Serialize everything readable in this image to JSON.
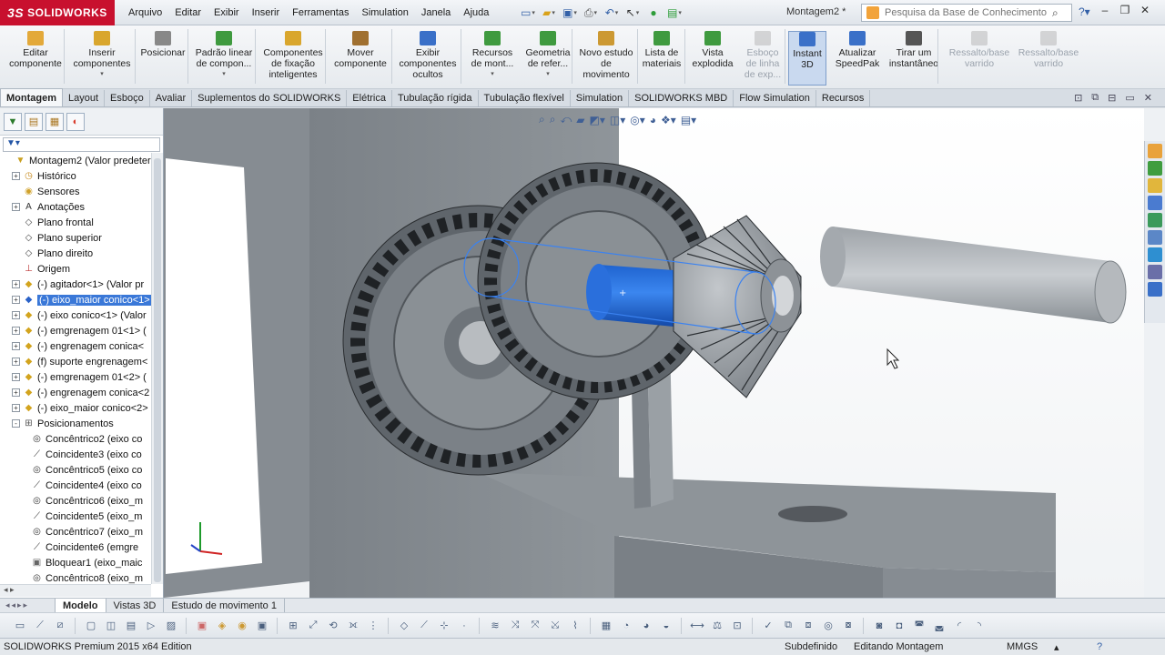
{
  "app": {
    "brand": "SOLIDWORKS",
    "doc_title": "Montagem2 *"
  },
  "menu": [
    "Arquivo",
    "Editar",
    "Exibir",
    "Inserir",
    "Ferramentas",
    "Simulation",
    "Janela",
    "Ajuda"
  ],
  "quick_access_icons": [
    "new-icon",
    "open-icon",
    "save-icon",
    "print-icon",
    "undo-icon",
    "select-icon",
    "rebuild-icon",
    "options-icon"
  ],
  "search": {
    "placeholder": "Pesquisa da Base de Conhecimento"
  },
  "commands": [
    {
      "label": "Editar componente",
      "icon": "edit-component-icon",
      "enabled": true
    },
    {
      "label": "Inserir componentes",
      "icon": "insert-components-icon",
      "enabled": true
    },
    {
      "label": "Posicionar",
      "icon": "mate-icon",
      "enabled": true
    },
    {
      "label": "Padrão linear de compon...",
      "icon": "linear-pattern-icon",
      "enabled": true
    },
    {
      "label": "Componentes de fixação inteligentes",
      "icon": "smart-fasteners-icon",
      "enabled": true
    },
    {
      "label": "Mover componente",
      "icon": "move-component-icon",
      "enabled": true
    },
    {
      "label": "Exibir componentes ocultos",
      "icon": "show-hidden-icon",
      "enabled": true
    },
    {
      "label": "Recursos de mont...",
      "icon": "assembly-features-icon",
      "enabled": true
    },
    {
      "label": "Geometria de refer...",
      "icon": "reference-geometry-icon",
      "enabled": true
    },
    {
      "label": "Novo estudo de movimento",
      "icon": "motion-study-icon",
      "enabled": true
    },
    {
      "label": "Lista de materiais",
      "icon": "bom-icon",
      "enabled": true
    },
    {
      "label": "Vista explodida",
      "icon": "exploded-view-icon",
      "enabled": true
    },
    {
      "label": "Esboço de linha de exp...",
      "icon": "explode-line-icon",
      "enabled": false
    },
    {
      "label": "Instant 3D",
      "icon": "instant3d-icon",
      "enabled": true,
      "active": true
    },
    {
      "label": "Atualizar SpeedPak",
      "icon": "speedpak-icon",
      "enabled": true
    },
    {
      "label": "Tirar um instantâneo",
      "icon": "snapshot-icon",
      "enabled": true
    },
    {
      "label": "Ressalto/base varrido",
      "icon": "sweep-boss-icon",
      "enabled": false
    },
    {
      "label": "Ressalto/base varrido",
      "icon": "sweep-boss-icon",
      "enabled": false
    }
  ],
  "tabs": [
    "Montagem",
    "Layout",
    "Esboço",
    "Avaliar",
    "Suplementos do SOLIDWORKS",
    "Elétrica",
    "Tubulação rígida",
    "Tubulação flexível",
    "Simulation",
    "SOLIDWORKS MBD",
    "Flow Simulation",
    "Recursos"
  ],
  "active_tab": "Montagem",
  "tree": [
    {
      "label": "Montagem2  (Valor predeter",
      "icon": "assembly-icon",
      "expander": "none",
      "indent": 0
    },
    {
      "label": "Histórico",
      "icon": "history-icon",
      "expander": "+",
      "indent": 1
    },
    {
      "label": "Sensores",
      "icon": "sensor-icon",
      "expander": "none",
      "indent": 1
    },
    {
      "label": "Anotações",
      "icon": "annotation-icon",
      "expander": "+",
      "indent": 1
    },
    {
      "label": "Plano frontal",
      "icon": "plane-icon",
      "expander": "none",
      "indent": 1
    },
    {
      "label": "Plano superior",
      "icon": "plane-icon",
      "expander": "none",
      "indent": 1
    },
    {
      "label": "Plano direito",
      "icon": "plane-icon",
      "expander": "none",
      "indent": 1
    },
    {
      "label": "Origem",
      "icon": "origin-icon",
      "expander": "none",
      "indent": 1
    },
    {
      "label": "(-) agitador<1> (Valor pr",
      "icon": "part-icon",
      "expander": "+",
      "indent": 1
    },
    {
      "label": "(-) eixo_maior conico<1>",
      "icon": "part-icon",
      "expander": "+",
      "indent": 1,
      "selected": true
    },
    {
      "label": "(-) eixo conico<1> (Valor",
      "icon": "part-icon",
      "expander": "+",
      "indent": 1
    },
    {
      "label": "(-) emgrenagem 01<1> (",
      "icon": "part-icon",
      "expander": "+",
      "indent": 1
    },
    {
      "label": "(-) engrenagem conica<",
      "icon": "part-icon",
      "expander": "+",
      "indent": 1
    },
    {
      "label": "(f) suporte engrenagem<",
      "icon": "part-icon",
      "expander": "+",
      "indent": 1
    },
    {
      "label": "(-) emgrenagem 01<2> (",
      "icon": "part-icon",
      "expander": "+",
      "indent": 1
    },
    {
      "label": "(-) engrenagem conica<2",
      "icon": "part-icon",
      "expander": "+",
      "indent": 1
    },
    {
      "label": "(-) eixo_maior conico<2>",
      "icon": "part-icon",
      "expander": "+",
      "indent": 1
    },
    {
      "label": "Posicionamentos",
      "icon": "mates-folder-icon",
      "expander": "-",
      "indent": 1
    },
    {
      "label": "Concêntrico2 (eixo co",
      "icon": "concentric-icon",
      "expander": "none",
      "indent": 2
    },
    {
      "label": "Coincidente3 (eixo co",
      "icon": "coincident-icon",
      "expander": "none",
      "indent": 2
    },
    {
      "label": "Concêntrico5 (eixo co",
      "icon": "concentric-icon",
      "expander": "none",
      "indent": 2
    },
    {
      "label": "Coincidente4 (eixo co",
      "icon": "coincident-icon",
      "expander": "none",
      "indent": 2
    },
    {
      "label": "Concêntrico6 (eixo_m",
      "icon": "concentric-icon",
      "expander": "none",
      "indent": 2
    },
    {
      "label": "Coincidente5 (eixo_m",
      "icon": "coincident-icon",
      "expander": "none",
      "indent": 2
    },
    {
      "label": "Concêntrico7 (eixo_m",
      "icon": "concentric-icon",
      "expander": "none",
      "indent": 2
    },
    {
      "label": "Coincidente6 (emgre",
      "icon": "coincident-icon",
      "expander": "none",
      "indent": 2
    },
    {
      "label": "Bloquear1 (eixo_maic",
      "icon": "lock-icon",
      "expander": "none",
      "indent": 2
    },
    {
      "label": "Concêntrico8 (eixo_m",
      "icon": "concentric-icon",
      "expander": "none",
      "indent": 2
    }
  ],
  "bottom_tabs": [
    "Modelo",
    "Vistas 3D",
    "Estudo de movimento 1"
  ],
  "active_bottom_tab": "Modelo",
  "status": {
    "edition": "SOLIDWORKS Premium 2015 x64 Edition",
    "definition": "Subdefinido",
    "mode": "Editando Montagem",
    "units": "MMGS"
  },
  "colors": {
    "brand_red": "#c8102e",
    "selection_blue": "#1a5fd0",
    "part_gray": "#8f959b",
    "tree_select": "#3a78d8"
  }
}
